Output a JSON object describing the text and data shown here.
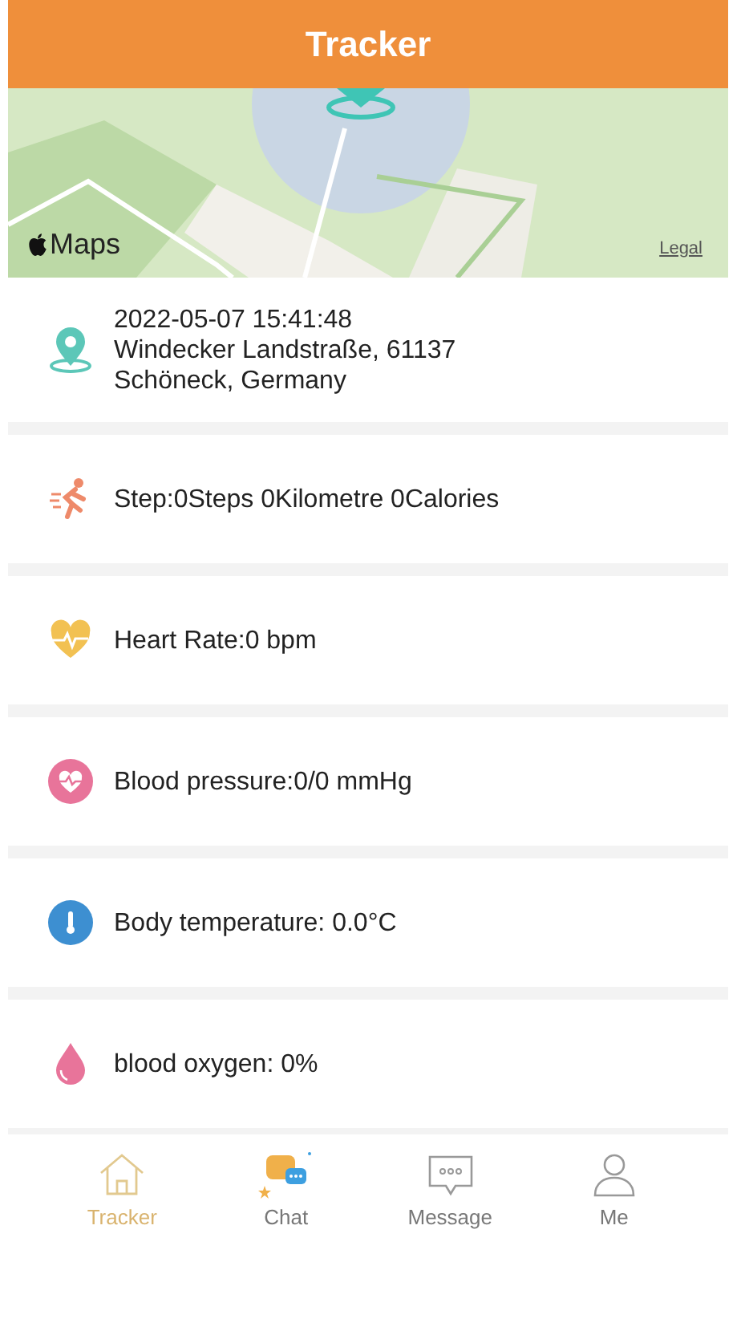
{
  "header": {
    "title": "Tracker"
  },
  "map": {
    "kind": "picture",
    "logo": "Maps",
    "legal": "Legal"
  },
  "items": [
    {
      "kind": "location",
      "lines": [
        "2022-05-07 15:41:48",
        "Windecker Landstraße, 61137",
        "Schöneck, Germany"
      ]
    },
    {
      "kind": "steps",
      "lines": [
        "Step:0Steps 0Kilometre 0Calories"
      ]
    },
    {
      "kind": "heart",
      "lines": [
        "Heart Rate:0 bpm"
      ]
    },
    {
      "kind": "pressure",
      "lines": [
        "Blood pressure:0/0 mmHg"
      ]
    },
    {
      "kind": "temperature",
      "lines": [
        "Body temperature: 0.0°C"
      ]
    },
    {
      "kind": "oxygen",
      "lines": [
        "blood oxygen: 0%"
      ]
    }
  ],
  "tabs": [
    {
      "kind": "home",
      "label": "Tracker",
      "selected": true
    },
    {
      "kind": "chat",
      "label": "Chat",
      "selected": false
    },
    {
      "kind": "message",
      "label": "Message",
      "selected": false
    },
    {
      "kind": "person",
      "label": "Me",
      "selected": false
    }
  ]
}
